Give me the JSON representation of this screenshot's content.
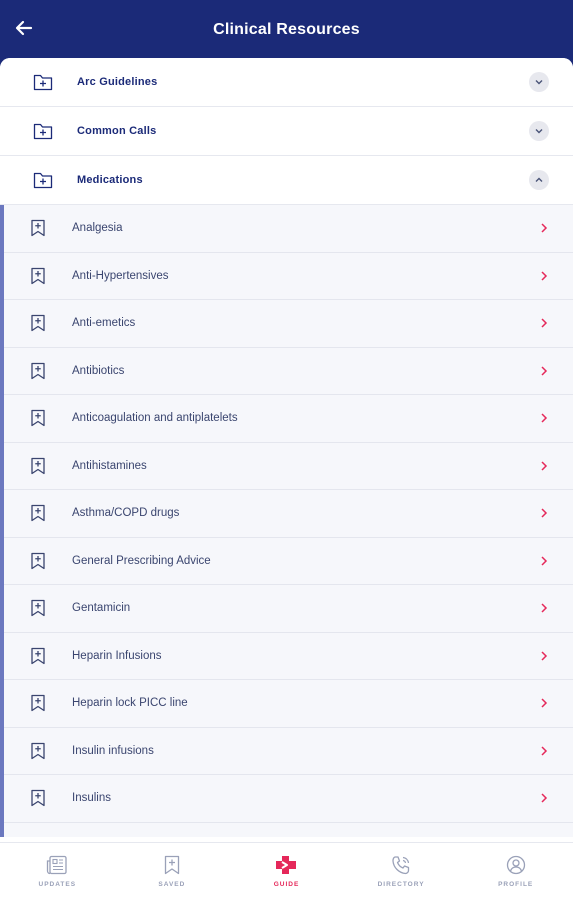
{
  "header": {
    "title": "Clinical Resources"
  },
  "sections": [
    {
      "label": "Arc Guidelines",
      "expanded": false
    },
    {
      "label": "Common Calls",
      "expanded": false
    },
    {
      "label": "Medications",
      "expanded": true
    }
  ],
  "medications": [
    "Analgesia",
    "Anti-Hypertensives",
    "Anti-emetics",
    "Antibiotics",
    "Anticoagulation and antiplatelets",
    "Antihistamines",
    "Asthma/COPD drugs",
    "General Prescribing Advice",
    "Gentamicin",
    "Heparin Infusions",
    "Heparin lock PICC line",
    "Insulin infusions",
    "Insulins"
  ],
  "tabs": [
    {
      "label": "UPDATES",
      "icon": "newspaper-icon"
    },
    {
      "label": "SAVED",
      "icon": "bookmark-plus-icon"
    },
    {
      "label": "GUIDE",
      "icon": "guide-cross-icon",
      "active": true
    },
    {
      "label": "DIRECTORY",
      "icon": "phone-icon"
    },
    {
      "label": "PROFILE",
      "icon": "user-circle-icon"
    }
  ],
  "colors": {
    "header": "#1b2a78",
    "accent": "#e5285a",
    "list_bar": "#6b78bf",
    "text": "#3a456f"
  }
}
